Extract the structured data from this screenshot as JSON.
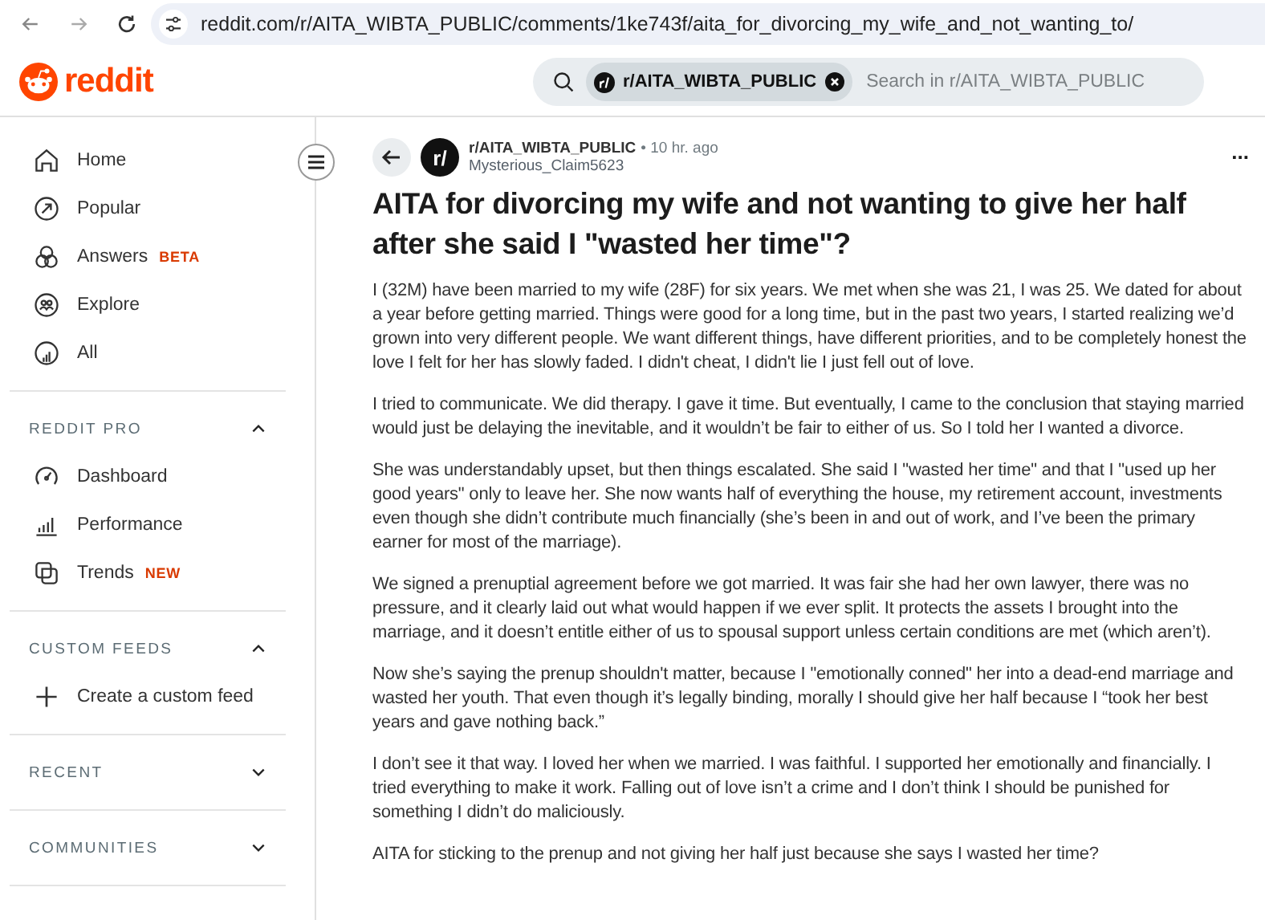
{
  "browser": {
    "url": "reddit.com/r/AITA_WIBTA_PUBLIC/comments/1ke743f/aita_for_divorcing_my_wife_and_not_wanting_to/"
  },
  "header": {
    "logo": "reddit",
    "search": {
      "chip": "r/AITA_WIBTA_PUBLIC",
      "placeholder": "Search in r/AITA_WIBTA_PUBLIC"
    }
  },
  "sidebar": {
    "items": [
      {
        "label": "Home"
      },
      {
        "label": "Popular"
      },
      {
        "label": "Answers",
        "badge": "BETA"
      },
      {
        "label": "Explore"
      },
      {
        "label": "All"
      }
    ],
    "sections": [
      {
        "title": "REDDIT PRO",
        "expanded": true,
        "items": [
          {
            "label": "Dashboard"
          },
          {
            "label": "Performance"
          },
          {
            "label": "Trends",
            "badge": "NEW"
          }
        ]
      },
      {
        "title": "CUSTOM FEEDS",
        "expanded": true,
        "items": [
          {
            "label": "Create a custom feed"
          }
        ]
      },
      {
        "title": "RECENT",
        "expanded": false
      },
      {
        "title": "COMMUNITIES",
        "expanded": false
      }
    ]
  },
  "post": {
    "avatar": "r/",
    "subreddit": "r/AITA_WIBTA_PUBLIC",
    "time": "• 10 hr. ago",
    "author": "Mysterious_Claim5623",
    "more": "...",
    "title": "AITA for divorcing my wife and not wanting to give her half after she said I \"wasted her time\"?",
    "paragraphs": [
      "I (32M) have been married to my wife (28F) for six years. We met when she was 21, I was 25. We dated for about a year before getting married. Things were good for a long time, but in the past two years, I started realizing we’d grown into very different people. We want different things, have different priorities, and to be completely honest the love I felt for her has slowly faded. I didn't cheat, I didn't lie I just fell out of love.",
      "I tried to communicate. We did therapy. I gave it time. But eventually, I came to the conclusion that staying married would just be delaying the inevitable, and it wouldn’t be fair to either of us. So I told her I wanted a divorce.",
      "She was understandably upset, but then things escalated. She said I \"wasted her time\" and that I \"used up her good years\" only to leave her. She now wants half of everything the house, my retirement account, investments even though she didn’t contribute much financially (she’s been in and out of work, and I’ve been the primary earner for most of the marriage).",
      "We signed a prenuptial agreement before we got married. It was fair she had her own lawyer, there was no pressure, and it clearly laid out what would happen if we ever split. It protects the assets I brought into the marriage, and it doesn’t entitle either of us to spousal support unless certain conditions are met (which aren’t).",
      "Now she’s saying the prenup shouldn't matter, because I \"emotionally conned\" her into a dead-end marriage and wasted her youth. That even though it’s legally binding, morally I should give her half because I “took her best years and gave nothing back.”",
      "I don’t see it that way. I loved her when we married. I was faithful. I supported her emotionally and financially. I tried everything to make it work. Falling out of love isn’t a crime and I don’t think I should be punished for something I didn’t do maliciously.",
      "AITA for sticking to the prenup and not giving her half just because she says I wasted her time?"
    ]
  }
}
